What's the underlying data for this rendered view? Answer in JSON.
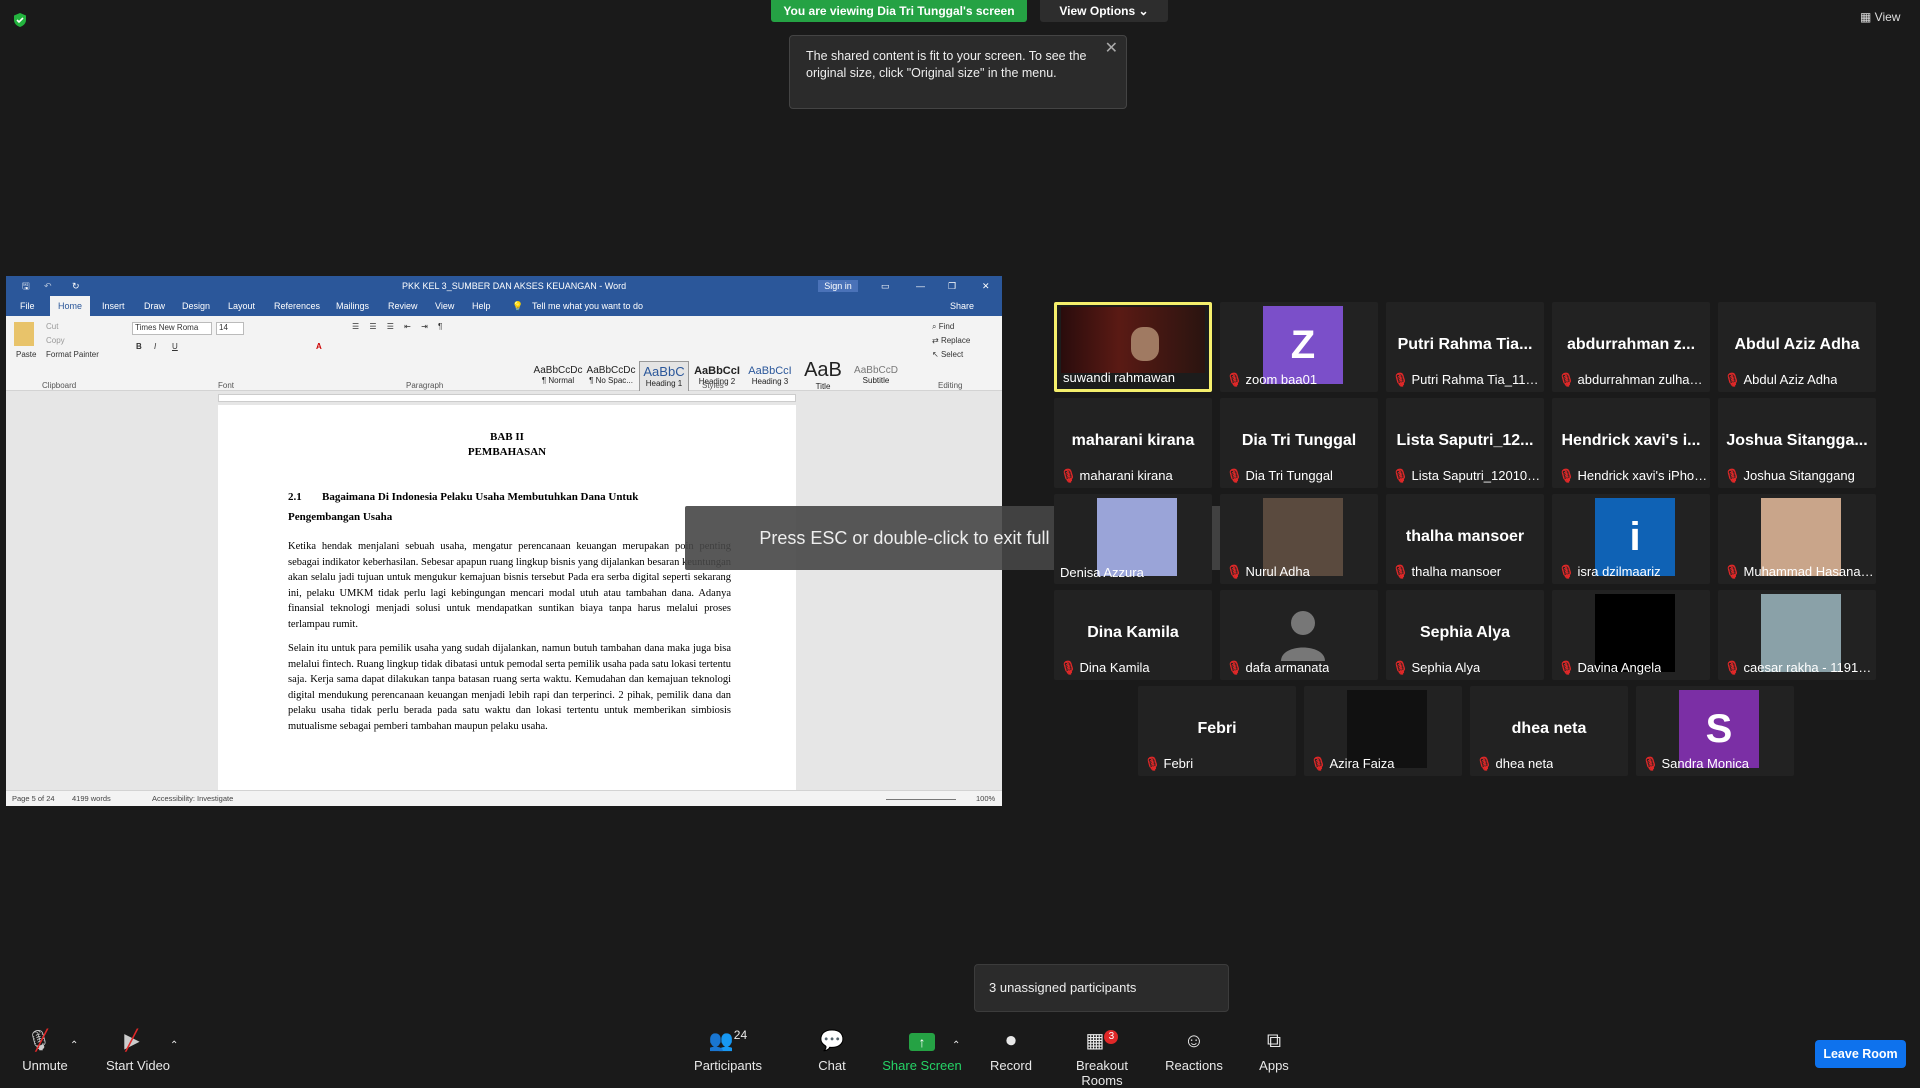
{
  "banner": {
    "viewing": "You are viewing Dia Tri Tunggal's screen",
    "view_options": "View Options"
  },
  "top_view_label": "View",
  "tooltip": {
    "text": "The shared content is fit to your screen. To see the original size, click \"Original size\" in the menu."
  },
  "esc_message": "Press ESC or double-click to exit full screen mode",
  "word": {
    "title": "PKK KEL 3_SUMBER DAN AKSES KEUANGAN - Word",
    "sign_in": "Sign in",
    "tabs": [
      "File",
      "Home",
      "Insert",
      "Draw",
      "Design",
      "Layout",
      "References",
      "Mailings",
      "Review",
      "View",
      "Help"
    ],
    "tell_me": "Tell me what you want to do",
    "share": "Share",
    "clipboard": {
      "paste": "Paste",
      "cut": "Cut",
      "copy": "Copy",
      "format_painter": "Format Painter",
      "group": "Clipboard"
    },
    "font": {
      "name": "Times New Roma",
      "size": "14",
      "group": "Font"
    },
    "paragraph_group": "Paragraph",
    "styles": [
      {
        "preview": "AaBbCcDc",
        "name": "¶ Normal"
      },
      {
        "preview": "AaBbCcDc",
        "name": "¶ No Spac..."
      },
      {
        "preview": "AaBbC",
        "name": "Heading 1"
      },
      {
        "preview": "AaBbCcI",
        "name": "Heading 2"
      },
      {
        "preview": "AaBbCcI",
        "name": "Heading 3"
      },
      {
        "preview": "AaB",
        "name": "Title"
      },
      {
        "preview": "AaBbCcD",
        "name": "Subtitle"
      }
    ],
    "styles_group": "Styles",
    "editing": {
      "find": "Find",
      "replace": "Replace",
      "select": "Select",
      "group": "Editing"
    },
    "doc": {
      "chapter": "BAB II",
      "chapter_title": "PEMBAHASAN",
      "section_num": "2.1",
      "section_line1": "Bagaimana Di Indonesia Pelaku Usaha Membutuhkan Dana Untuk",
      "section_line2": "Pengembangan Usaha",
      "para1": "Ketika hendak menjalani sebuah usaha, mengatur perencanaan keuangan merupakan poin penting sebagai indikator keberhasilan. Sebesar apapun ruang lingkup bisnis yang dijalankan besaran keuntungan akan selalu jadi tujuan untuk mengukur kemajuan bisnis tersebut Pada era serba digital seperti sekarang ini, pelaku UMKM tidak perlu lagi kebingungan mencari modal utuh atau tambahan dana. Adanya finansial teknologi menjadi solusi untuk mendapatkan suntikan biaya tanpa harus melalui proses terlampau rumit.",
      "para2": "Selain itu untuk para pemilik usaha yang sudah dijalankan, namun butuh tambahan dana maka juga bisa melalui fintech. Ruang lingkup tidak dibatasi untuk pemodal serta pemilik usaha pada satu lokasi tertentu saja. Kerja sama dapat dilakukan tanpa batasan ruang serta waktu. Kemudahan dan kemajuan teknologi digital mendukung perencanaan keuangan menjadi lebih rapi dan terperinci. 2 pihak, pemilik dana dan pelaku usaha tidak perlu berada pada satu waktu dan lokasi tertentu untuk memberikan simbiosis mutualisme sebagai pemberi tambahan maupun pelaku usaha."
    },
    "status": {
      "page": "Page 5 of 24",
      "words": "4199 words",
      "accessibility": "Accessibility: Investigate",
      "zoom": "100%"
    }
  },
  "participants": [
    {
      "display": "",
      "label": "suwandi rahmawan",
      "avatar": "video-person-presentation",
      "active": true,
      "muted": false
    },
    {
      "display": "Z",
      "label": "zoom baa01",
      "avatar": "letter",
      "color": "#7b4fc9",
      "muted": true
    },
    {
      "display": "Putri Rahma Tia...",
      "label": "Putri Rahma Tia_1191...",
      "avatar": "name",
      "muted": true
    },
    {
      "display": "abdurrahman z...",
      "label": "abdurrahman zulhazmi",
      "avatar": "name",
      "muted": true
    },
    {
      "display": "Abdul Aziz Adha",
      "label": "Abdul Aziz Adha",
      "avatar": "name",
      "muted": true
    },
    {
      "display": "maharani kirana",
      "label": "maharani kirana",
      "avatar": "name",
      "muted": true
    },
    {
      "display": "Dia Tri Tunggal",
      "label": "Dia Tri Tunggal",
      "avatar": "name",
      "muted": true
    },
    {
      "display": "Lista Saputri_12...",
      "label": "Lista Saputri_1201001...",
      "avatar": "name",
      "muted": true
    },
    {
      "display": "Hendrick xavi's i...",
      "label": "Hendrick xavi's iPhone",
      "avatar": "name",
      "muted": true
    },
    {
      "display": "Joshua Sitangga...",
      "label": "Joshua Sitanggang",
      "avatar": "name",
      "muted": true
    },
    {
      "display": "",
      "label": "Denisa Azzura",
      "avatar": "photo",
      "color": "#9aa4d8",
      "muted": false
    },
    {
      "display": "",
      "label": "Nurul Adha",
      "avatar": "photo",
      "color": "#5a4a3e",
      "muted": true
    },
    {
      "display": "thalha mansoer",
      "label": "thalha mansoer",
      "avatar": "name",
      "muted": true
    },
    {
      "display": "i",
      "label": "isra dzilmaariz",
      "avatar": "letter",
      "color": "#0f62b5",
      "muted": true
    },
    {
      "display": "",
      "label": "Muhammad Hasanal ...",
      "avatar": "photo",
      "color": "#c9a58a",
      "muted": true
    },
    {
      "display": "Dina Kamila",
      "label": "Dina Kamila",
      "avatar": "name",
      "muted": true
    },
    {
      "display": "",
      "label": "dafa armanata",
      "avatar": "default",
      "muted": true
    },
    {
      "display": "Sephia Alya",
      "label": "Sephia Alya",
      "avatar": "name",
      "muted": true
    },
    {
      "display": "",
      "label": "Davina Angela",
      "avatar": "photo",
      "color": "#000000",
      "muted": true
    },
    {
      "display": "",
      "label": "caesar rakha - 11910...",
      "avatar": "photo",
      "color": "#8aa1a8",
      "muted": true
    },
    {
      "display": "Febri",
      "label": "Febri",
      "avatar": "name",
      "muted": true
    },
    {
      "display": "",
      "label": "Azira Faiza",
      "avatar": "photo",
      "color": "#111111",
      "muted": true
    },
    {
      "display": "dhea neta",
      "label": "dhea neta",
      "avatar": "name",
      "muted": true
    },
    {
      "display": "S",
      "label": "Sandra Monica",
      "avatar": "letter",
      "color": "#7b2fa5",
      "muted": true
    }
  ],
  "unassigned": "3 unassigned participants",
  "toolbar": {
    "unmute": "Unmute",
    "start_video": "Start Video",
    "participants": "Participants",
    "participants_count": "24",
    "chat": "Chat",
    "share_screen": "Share Screen",
    "record": "Record",
    "breakout_rooms": "Breakout Rooms",
    "breakout_badge": "3",
    "reactions": "Reactions",
    "apps": "Apps",
    "leave": "Leave Room"
  },
  "colors": {
    "green": "#25a244",
    "word_blue": "#2b579a",
    "leave_blue": "#0e72ed",
    "active_border": "#f5ef6c",
    "muted_red": "#e02828"
  }
}
